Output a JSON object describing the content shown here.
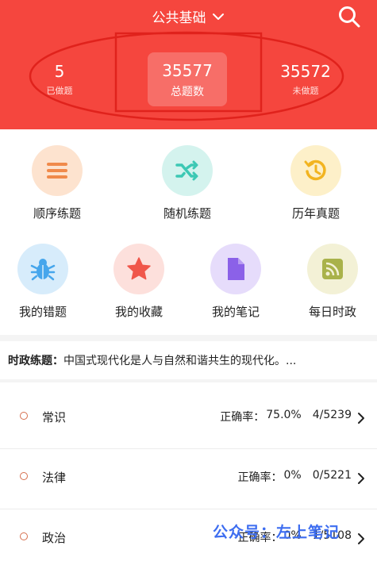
{
  "header": {
    "title": "公共基础",
    "stats": [
      {
        "value": "5",
        "label": "已做题"
      },
      {
        "value": "35577",
        "label": "总题数"
      },
      {
        "value": "35572",
        "label": "未做题"
      }
    ]
  },
  "colors": {
    "header_bg": "#f5463e",
    "annotation": "#e0221c",
    "watermark": "#3d6df0"
  },
  "grid": {
    "row1": [
      {
        "label": "顺序练题",
        "icon": "list-icon",
        "bg": "#fde3cf",
        "fg": "#f08a4b"
      },
      {
        "label": "随机练题",
        "icon": "shuffle-icon",
        "bg": "#d4f3ee",
        "fg": "#3cc8b4"
      },
      {
        "label": "历年真题",
        "icon": "history-icon",
        "bg": "#fdf0c9",
        "fg": "#f2b420"
      }
    ],
    "row2": [
      {
        "label": "我的错题",
        "icon": "bug-icon",
        "bg": "#d7ecfb",
        "fg": "#46a6ec"
      },
      {
        "label": "我的收藏",
        "icon": "star-icon",
        "bg": "#fde0dc",
        "fg": "#f0564a"
      },
      {
        "label": "我的笔记",
        "icon": "document-icon",
        "bg": "#e6dcfb",
        "fg": "#8b61e8"
      },
      {
        "label": "每日时政",
        "icon": "rss-icon",
        "bg": "#f3f1d6",
        "fg": "#a9b24a"
      }
    ]
  },
  "news": {
    "prefix": "时政练题：",
    "text": "中国式现代化是人与自然和谐共生的现代化。..."
  },
  "list": [
    {
      "name": "常识",
      "acc_label": "正确率：",
      "acc": "75.0%",
      "progress": "4/5239"
    },
    {
      "name": "法律",
      "acc_label": "正确率：",
      "acc": "0%",
      "progress": "0/5221"
    },
    {
      "name": "政治",
      "acc_label": "正确率：",
      "acc": "0%",
      "progress": "1/5108"
    }
  ],
  "watermark": "公众号：左上笔记"
}
